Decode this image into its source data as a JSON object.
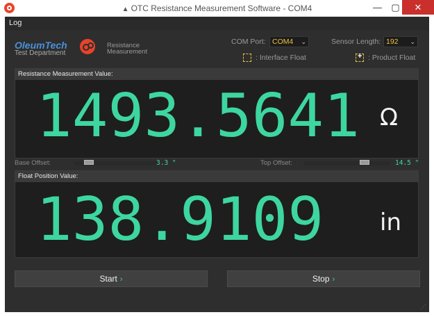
{
  "window": {
    "title": "OTC Resistance Measurement Software - COM4",
    "title_glyph": "▲",
    "min_glyph": "—",
    "max_glyph": "▢",
    "close_glyph": "✕"
  },
  "menu": {
    "log": "Log"
  },
  "brand": {
    "name": "OleumTech",
    "department": "Test Department",
    "subtitle": "Resistance Measurement"
  },
  "settings": {
    "com_port_label": "COM Port:",
    "com_port_value": "COM4",
    "sensor_length_label": "Sensor Length:",
    "sensor_length_value": "192",
    "interface_float_label": ": Interface Float",
    "product_float_label": ": Product Float",
    "dropdown_glyph": "⌄"
  },
  "resistance": {
    "header": "Resistance Measurement Value:",
    "value": "1493.5641",
    "unit": "Ω"
  },
  "offsets": {
    "base_label": "Base Offset:",
    "base_value": "3.3 \"",
    "top_label": "Top Offset:",
    "top_value": "14.5 \""
  },
  "float_position": {
    "header": "Float Position Value:",
    "value": "138.9109",
    "unit": "in"
  },
  "buttons": {
    "start": "Start",
    "stop": "Stop",
    "arrow_glyph": "›"
  },
  "status": {
    "grip_glyph": "⋰"
  },
  "colors": {
    "accent_green": "#3ed6a0",
    "brand_blue": "#4a90d9",
    "dropdown_text": "#f0c040",
    "close_red": "#c9302c",
    "logo_red": "#e7432a"
  }
}
